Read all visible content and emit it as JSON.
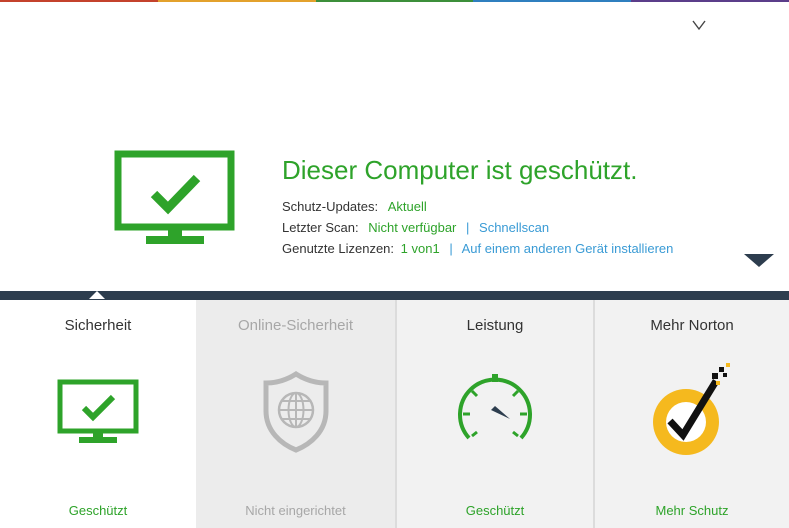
{
  "colors": {
    "accent_green": "#2ea32a",
    "link_blue": "#3a9bd5",
    "band_dark": "#2d3d4e",
    "norton_yellow": "#f5b91e"
  },
  "header": {
    "expand_icon": "chevron-down-icon"
  },
  "status": {
    "icon": "monitor-check-icon",
    "title": "Dieser Computer ist geschützt.",
    "updates_label": "Schutz-Updates:",
    "updates_value": "Aktuell",
    "scan_label": "Letzter Scan:",
    "scan_value": "Nicht verfügbar",
    "scan_separator": "|",
    "scan_action": "Schnellscan",
    "licenses_label": "Genutzte Lizenzen:",
    "licenses_value": "1 von1",
    "licenses_separator": "|",
    "licenses_action": "Auf einem anderen Gerät installieren"
  },
  "tiles": [
    {
      "title": "Sicherheit",
      "status": "Geschützt",
      "icon": "monitor-check-icon"
    },
    {
      "title": "Online-Sicherheit",
      "status": "Nicht eingerichtet",
      "icon": "shield-globe-icon"
    },
    {
      "title": "Leistung",
      "status": "Geschützt",
      "icon": "speedometer-icon"
    },
    {
      "title": "Mehr Norton",
      "status": "Mehr Schutz",
      "icon": "norton-logo-icon"
    }
  ]
}
